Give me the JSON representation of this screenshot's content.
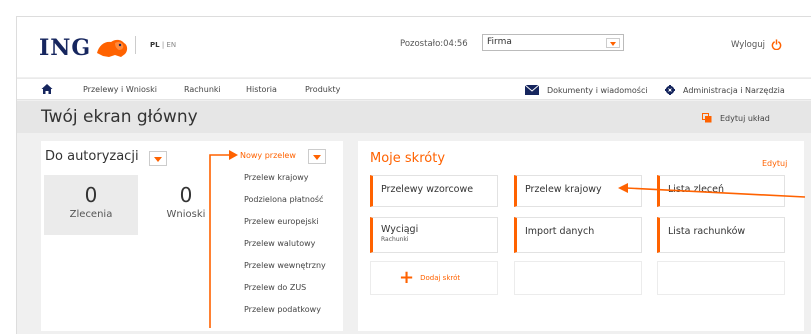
{
  "header": {
    "logo": "ING",
    "lang_active": "PL",
    "lang_separator": "|",
    "lang_other": "EN",
    "session_timer": "Pozostało:04:56",
    "company_select": "Firma",
    "logout": "Wyloguj"
  },
  "nav": {
    "items": [
      "Przelewy i Wnioski",
      "Rachunki",
      "Historia",
      "Produkty"
    ],
    "documents": "Dokumenty i wiadomości",
    "admin": "Administracja i Narzędzia"
  },
  "page": {
    "title": "Twój ekran główny",
    "edit_layout": "Edytuj układ"
  },
  "authorization": {
    "title": "Do autoryzacji",
    "stats": [
      {
        "value": "0",
        "label": "Zlecenia"
      },
      {
        "value": "0",
        "label": "Wnioski"
      }
    ]
  },
  "new_transfer": {
    "label": "Nowy przelew",
    "options": [
      "Przelew krajowy",
      "Podzielona płatność",
      "Przelew europejski",
      "Przelew walutowy",
      "Przelew wewnętrzny",
      "Przelew do ZUS",
      "Przelew podatkowy"
    ]
  },
  "shortcuts": {
    "title": "Moje skróty",
    "edit": "Edytuj",
    "tiles": [
      {
        "label": "Przelewy wzorcowe",
        "sub": ""
      },
      {
        "label": "Przelew krajowy",
        "sub": ""
      },
      {
        "label": "Lista zleceń",
        "sub": ""
      },
      {
        "label": "Wyciągi",
        "sub": "Rachunki"
      },
      {
        "label": "Import danych",
        "sub": ""
      },
      {
        "label": "Lista rachunków",
        "sub": ""
      }
    ],
    "add": "Dodaj skrót"
  },
  "colors": {
    "accent": "#ff6200",
    "brand_navy": "#16265e",
    "background": "#f0f0f0"
  }
}
